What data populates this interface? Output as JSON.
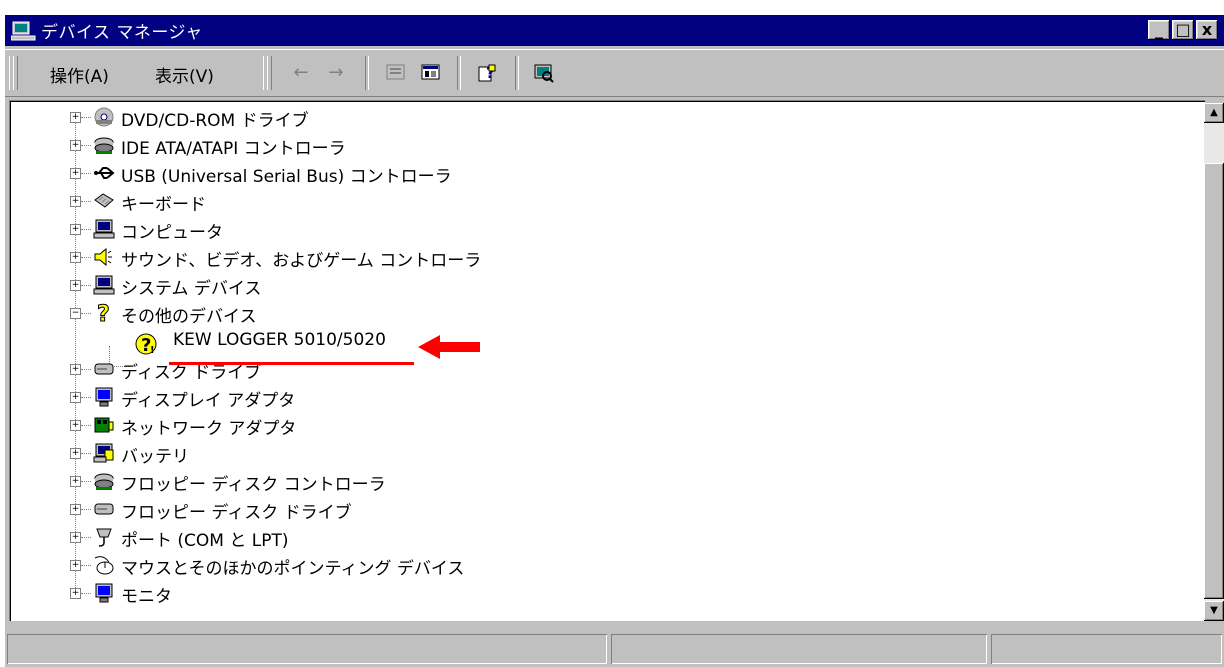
{
  "window": {
    "title": "デバイス マネージャ",
    "controls": {
      "minimize": "_",
      "maximize": "□",
      "close": "x"
    }
  },
  "toolbar": {
    "menu": [
      {
        "label": "操作(A)"
      },
      {
        "label": "表示(V)"
      }
    ],
    "icons": [
      "back-arrow-icon",
      "forward-arrow-icon",
      "properties-icon",
      "view-icon",
      "help-icon",
      "scan-hardware-icon"
    ]
  },
  "tree": {
    "items": [
      {
        "label": "DVD/CD-ROM ドライブ",
        "icon": "dvd-drive-icon",
        "expander": "+"
      },
      {
        "label": "IDE ATA/ATAPI コントローラ",
        "icon": "ide-controller-icon",
        "expander": "+"
      },
      {
        "label": "USB (Universal Serial Bus) コントローラ",
        "icon": "usb-icon",
        "expander": "+"
      },
      {
        "label": "キーボード",
        "icon": "keyboard-icon",
        "expander": "+"
      },
      {
        "label": "コンピュータ",
        "icon": "computer-icon",
        "expander": "+"
      },
      {
        "label": "サウンド、ビデオ、およびゲーム コントローラ",
        "icon": "speaker-icon",
        "expander": "+"
      },
      {
        "label": "システム デバイス",
        "icon": "system-device-icon",
        "expander": "+"
      },
      {
        "label": "その他のデバイス",
        "icon": "unknown-device-icon",
        "expander": "−"
      },
      {
        "label": "KEW LOGGER 5010/5020",
        "icon": "unknown-device-warning-icon",
        "child": true
      },
      {
        "label": "ディスク ドライブ",
        "icon": "disk-drive-icon",
        "expander": "+"
      },
      {
        "label": "ディスプレイ アダプタ",
        "icon": "display-adapter-icon",
        "expander": "+"
      },
      {
        "label": "ネットワーク アダプタ",
        "icon": "network-adapter-icon",
        "expander": "+"
      },
      {
        "label": "バッテリ",
        "icon": "battery-icon",
        "expander": "+"
      },
      {
        "label": "フロッピー ディスク コントローラ",
        "icon": "floppy-controller-icon",
        "expander": "+"
      },
      {
        "label": "フロッピー ディスク ドライブ",
        "icon": "floppy-drive-icon",
        "expander": "+"
      },
      {
        "label": "ポート (COM と LPT)",
        "icon": "port-icon",
        "expander": "+"
      },
      {
        "label": "マウスとそのほかのポインティング デバイス",
        "icon": "mouse-icon",
        "expander": "+"
      },
      {
        "label": "モニタ",
        "icon": "monitor-icon",
        "expander": "+"
      }
    ]
  },
  "annotation": {
    "color": "#ff0000"
  },
  "scrollbar": {
    "up": "▲",
    "down": "▼"
  }
}
